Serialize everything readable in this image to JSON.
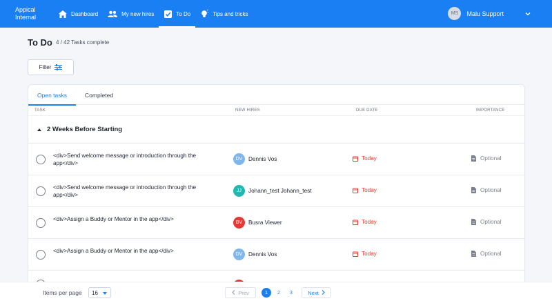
{
  "app": {
    "brand_line1": "Appical",
    "brand_line2": "Internal"
  },
  "nav": [
    {
      "label": "Dashboard",
      "icon": "home-icon",
      "active": false
    },
    {
      "label": "My new hires",
      "icon": "people-icon",
      "active": false
    },
    {
      "label": "To Do",
      "icon": "checkbox-icon",
      "active": true
    },
    {
      "label": "Tips and tricks",
      "icon": "lightbulb-icon",
      "active": false
    }
  ],
  "user": {
    "initials": "MS",
    "name": "Malu Support"
  },
  "page": {
    "title": "To Do",
    "subtitle": "4 / 42 Tasks complete"
  },
  "filter": {
    "label": "Filter"
  },
  "tabs": [
    {
      "label": "Open tasks",
      "active": true
    },
    {
      "label": "Completed",
      "active": false
    }
  ],
  "columns": {
    "task": "TASK",
    "new_hires": "NEW HIRES",
    "due_date": "DUE DATE",
    "importance": "IMPORTANCE"
  },
  "group": {
    "title": "2 Weeks Before Starting"
  },
  "rows": [
    {
      "task": "<div>Send welcome message or introduction through the app</div>",
      "hire_initials": "DV",
      "hire_name": "Dennis Vos",
      "hire_color": "#7fb6ec",
      "due": "Today",
      "importance": "Optional"
    },
    {
      "task": "<div>Send welcome message or introduction through the app</div>",
      "hire_initials": "JJ",
      "hire_name": "Johann_test Johann_test",
      "hire_color": "#20b8b0",
      "due": "Today",
      "importance": "Optional"
    },
    {
      "task": "<div>Assign a Buddy or Mentor in the app</div>",
      "hire_initials": "BV",
      "hire_name": "Busra Viewer",
      "hire_color": "#e53935",
      "due": "Today",
      "importance": "Optional"
    },
    {
      "task": "<div>Assign a Buddy or Mentor in the app</div>",
      "hire_initials": "DV",
      "hire_name": "Dennis Vos",
      "hire_color": "#7fb6ec",
      "due": "Today",
      "importance": "Optional"
    }
  ],
  "pagination": {
    "items_per_page_label": "Items per page",
    "items_per_page_value": "16",
    "prev_label": "Prev",
    "next_label": "Next",
    "pages": [
      "1",
      "2",
      "3"
    ],
    "current_page": "1"
  },
  "colors": {
    "primary": "#1a7ff2",
    "due_red": "#e53935",
    "muted": "#7a808c"
  }
}
